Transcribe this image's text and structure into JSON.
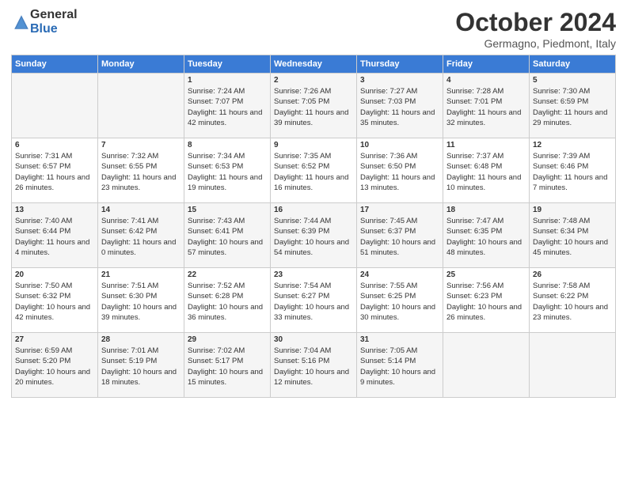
{
  "header": {
    "logo_general": "General",
    "logo_blue": "Blue",
    "month_title": "October 2024",
    "location": "Germagno, Piedmont, Italy"
  },
  "weekdays": [
    "Sunday",
    "Monday",
    "Tuesday",
    "Wednesday",
    "Thursday",
    "Friday",
    "Saturday"
  ],
  "weeks": [
    [
      {
        "day": "",
        "sunrise": "",
        "sunset": "",
        "daylight": ""
      },
      {
        "day": "",
        "sunrise": "",
        "sunset": "",
        "daylight": ""
      },
      {
        "day": "1",
        "sunrise": "Sunrise: 7:24 AM",
        "sunset": "Sunset: 7:07 PM",
        "daylight": "Daylight: 11 hours and 42 minutes."
      },
      {
        "day": "2",
        "sunrise": "Sunrise: 7:26 AM",
        "sunset": "Sunset: 7:05 PM",
        "daylight": "Daylight: 11 hours and 39 minutes."
      },
      {
        "day": "3",
        "sunrise": "Sunrise: 7:27 AM",
        "sunset": "Sunset: 7:03 PM",
        "daylight": "Daylight: 11 hours and 35 minutes."
      },
      {
        "day": "4",
        "sunrise": "Sunrise: 7:28 AM",
        "sunset": "Sunset: 7:01 PM",
        "daylight": "Daylight: 11 hours and 32 minutes."
      },
      {
        "day": "5",
        "sunrise": "Sunrise: 7:30 AM",
        "sunset": "Sunset: 6:59 PM",
        "daylight": "Daylight: 11 hours and 29 minutes."
      }
    ],
    [
      {
        "day": "6",
        "sunrise": "Sunrise: 7:31 AM",
        "sunset": "Sunset: 6:57 PM",
        "daylight": "Daylight: 11 hours and 26 minutes."
      },
      {
        "day": "7",
        "sunrise": "Sunrise: 7:32 AM",
        "sunset": "Sunset: 6:55 PM",
        "daylight": "Daylight: 11 hours and 23 minutes."
      },
      {
        "day": "8",
        "sunrise": "Sunrise: 7:34 AM",
        "sunset": "Sunset: 6:53 PM",
        "daylight": "Daylight: 11 hours and 19 minutes."
      },
      {
        "day": "9",
        "sunrise": "Sunrise: 7:35 AM",
        "sunset": "Sunset: 6:52 PM",
        "daylight": "Daylight: 11 hours and 16 minutes."
      },
      {
        "day": "10",
        "sunrise": "Sunrise: 7:36 AM",
        "sunset": "Sunset: 6:50 PM",
        "daylight": "Daylight: 11 hours and 13 minutes."
      },
      {
        "day": "11",
        "sunrise": "Sunrise: 7:37 AM",
        "sunset": "Sunset: 6:48 PM",
        "daylight": "Daylight: 11 hours and 10 minutes."
      },
      {
        "day": "12",
        "sunrise": "Sunrise: 7:39 AM",
        "sunset": "Sunset: 6:46 PM",
        "daylight": "Daylight: 11 hours and 7 minutes."
      }
    ],
    [
      {
        "day": "13",
        "sunrise": "Sunrise: 7:40 AM",
        "sunset": "Sunset: 6:44 PM",
        "daylight": "Daylight: 11 hours and 4 minutes."
      },
      {
        "day": "14",
        "sunrise": "Sunrise: 7:41 AM",
        "sunset": "Sunset: 6:42 PM",
        "daylight": "Daylight: 11 hours and 0 minutes."
      },
      {
        "day": "15",
        "sunrise": "Sunrise: 7:43 AM",
        "sunset": "Sunset: 6:41 PM",
        "daylight": "Daylight: 10 hours and 57 minutes."
      },
      {
        "day": "16",
        "sunrise": "Sunrise: 7:44 AM",
        "sunset": "Sunset: 6:39 PM",
        "daylight": "Daylight: 10 hours and 54 minutes."
      },
      {
        "day": "17",
        "sunrise": "Sunrise: 7:45 AM",
        "sunset": "Sunset: 6:37 PM",
        "daylight": "Daylight: 10 hours and 51 minutes."
      },
      {
        "day": "18",
        "sunrise": "Sunrise: 7:47 AM",
        "sunset": "Sunset: 6:35 PM",
        "daylight": "Daylight: 10 hours and 48 minutes."
      },
      {
        "day": "19",
        "sunrise": "Sunrise: 7:48 AM",
        "sunset": "Sunset: 6:34 PM",
        "daylight": "Daylight: 10 hours and 45 minutes."
      }
    ],
    [
      {
        "day": "20",
        "sunrise": "Sunrise: 7:50 AM",
        "sunset": "Sunset: 6:32 PM",
        "daylight": "Daylight: 10 hours and 42 minutes."
      },
      {
        "day": "21",
        "sunrise": "Sunrise: 7:51 AM",
        "sunset": "Sunset: 6:30 PM",
        "daylight": "Daylight: 10 hours and 39 minutes."
      },
      {
        "day": "22",
        "sunrise": "Sunrise: 7:52 AM",
        "sunset": "Sunset: 6:28 PM",
        "daylight": "Daylight: 10 hours and 36 minutes."
      },
      {
        "day": "23",
        "sunrise": "Sunrise: 7:54 AM",
        "sunset": "Sunset: 6:27 PM",
        "daylight": "Daylight: 10 hours and 33 minutes."
      },
      {
        "day": "24",
        "sunrise": "Sunrise: 7:55 AM",
        "sunset": "Sunset: 6:25 PM",
        "daylight": "Daylight: 10 hours and 30 minutes."
      },
      {
        "day": "25",
        "sunrise": "Sunrise: 7:56 AM",
        "sunset": "Sunset: 6:23 PM",
        "daylight": "Daylight: 10 hours and 26 minutes."
      },
      {
        "day": "26",
        "sunrise": "Sunrise: 7:58 AM",
        "sunset": "Sunset: 6:22 PM",
        "daylight": "Daylight: 10 hours and 23 minutes."
      }
    ],
    [
      {
        "day": "27",
        "sunrise": "Sunrise: 6:59 AM",
        "sunset": "Sunset: 5:20 PM",
        "daylight": "Daylight: 10 hours and 20 minutes."
      },
      {
        "day": "28",
        "sunrise": "Sunrise: 7:01 AM",
        "sunset": "Sunset: 5:19 PM",
        "daylight": "Daylight: 10 hours and 18 minutes."
      },
      {
        "day": "29",
        "sunrise": "Sunrise: 7:02 AM",
        "sunset": "Sunset: 5:17 PM",
        "daylight": "Daylight: 10 hours and 15 minutes."
      },
      {
        "day": "30",
        "sunrise": "Sunrise: 7:04 AM",
        "sunset": "Sunset: 5:16 PM",
        "daylight": "Daylight: 10 hours and 12 minutes."
      },
      {
        "day": "31",
        "sunrise": "Sunrise: 7:05 AM",
        "sunset": "Sunset: 5:14 PM",
        "daylight": "Daylight: 10 hours and 9 minutes."
      },
      {
        "day": "",
        "sunrise": "",
        "sunset": "",
        "daylight": ""
      },
      {
        "day": "",
        "sunrise": "",
        "sunset": "",
        "daylight": ""
      }
    ]
  ]
}
